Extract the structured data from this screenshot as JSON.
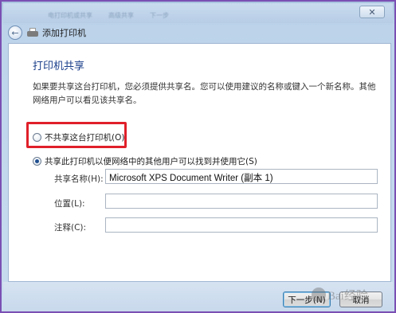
{
  "window": {
    "blurred_tabs": [
      "电打印机或共享",
      "高级共享",
      "下一步"
    ],
    "close_label": "✕"
  },
  "nav": {
    "back_glyph": "←",
    "title": "添加打印机"
  },
  "page": {
    "heading": "打印机共享",
    "description": "如果要共享这台打印机，您必须提供共享名。您可以使用建议的名称或键入一个新名称。其他网络用户可以看见该共享名。"
  },
  "options": {
    "no_share_label": "不共享这台打印机(O)",
    "no_share_checked": false,
    "share_label": "共享此打印机以便网络中的其他用户可以找到并使用它(S)",
    "share_checked": true
  },
  "fields": {
    "share_name_label": "共享名称(H):",
    "share_name_value": "Microsoft XPS Document Writer (副本 1)",
    "location_label": "位置(L):",
    "location_value": "",
    "comment_label": "注释(C):",
    "comment_value": ""
  },
  "buttons": {
    "next_label": "下一步(N)",
    "cancel_label": "取消"
  },
  "watermark": {
    "text": "Bai经验"
  },
  "colors": {
    "highlight": "#e0202a",
    "heading": "#1a3e8a",
    "frame": "#7a4fb3"
  }
}
